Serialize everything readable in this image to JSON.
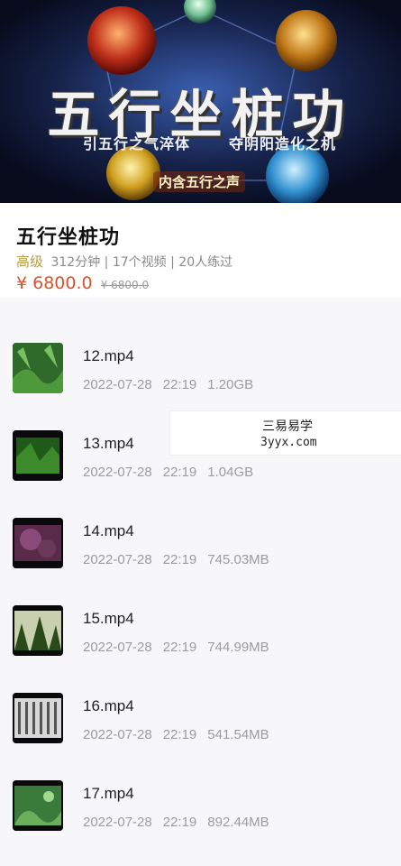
{
  "banner": {
    "title": "五行坐桩功",
    "subtitle_left": "引五行之气淬体",
    "subtitle_right": "夺阴阳造化之机",
    "badge": "内含五行之声"
  },
  "course": {
    "title": "五行坐桩功",
    "level": "高级",
    "minutes": "312分钟",
    "videos": "17个视频",
    "learners": "20人练过",
    "separator": "|",
    "price": "¥ 6800.0",
    "original_price": "¥ 6800.0"
  },
  "files": [
    {
      "name": "12.mp4",
      "date": "2022-07-28",
      "time": "22:19",
      "size": "1.20GB"
    },
    {
      "name": "13.mp4",
      "date": "2022-07-28",
      "time": "22:19",
      "size": "1.04GB"
    },
    {
      "name": "14.mp4",
      "date": "2022-07-28",
      "time": "22:19",
      "size": "745.03MB"
    },
    {
      "name": "15.mp4",
      "date": "2022-07-28",
      "time": "22:19",
      "size": "744.99MB"
    },
    {
      "name": "16.mp4",
      "date": "2022-07-28",
      "time": "22:19",
      "size": "541.54MB"
    },
    {
      "name": "17.mp4",
      "date": "2022-07-28",
      "time": "22:19",
      "size": "892.44MB"
    }
  ],
  "watermark": {
    "line1": "三易易学",
    "line2": "3yyx.com"
  },
  "colors": {
    "price": "#e0502a",
    "level": "#b89a46",
    "banner_bg": "#0d1530"
  }
}
